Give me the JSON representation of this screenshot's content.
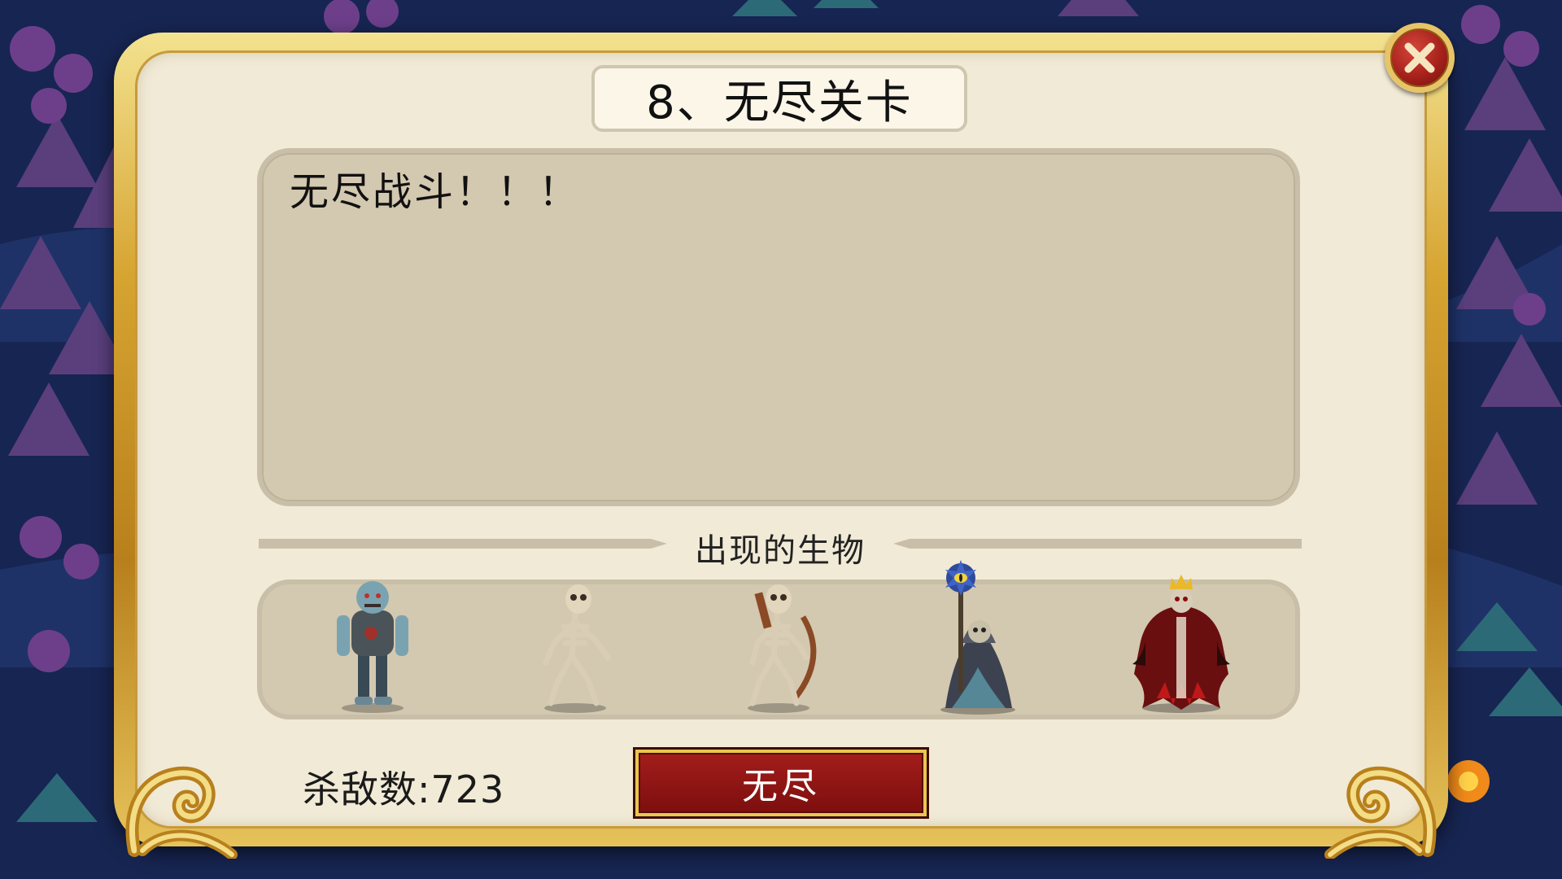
{
  "dialog": {
    "title": "8、无尽关卡",
    "description": "无尽战斗！！！",
    "creatures_heading": "出现的生物",
    "creatures": [
      {
        "icon": "zombie-icon"
      },
      {
        "icon": "skeleton-icon"
      },
      {
        "icon": "skeleton-archer-icon"
      },
      {
        "icon": "lich-mage-icon"
      },
      {
        "icon": "crowned-demon-lord-icon"
      }
    ],
    "kill_count_text": "杀敌数:723",
    "endless_button_label": "无尽",
    "close_icon": "close-icon"
  },
  "colors": {
    "panel": "#d3c8b0",
    "parchment": "#f1ead6",
    "gold": "#d6a431",
    "button_red": "#a31d1b"
  }
}
